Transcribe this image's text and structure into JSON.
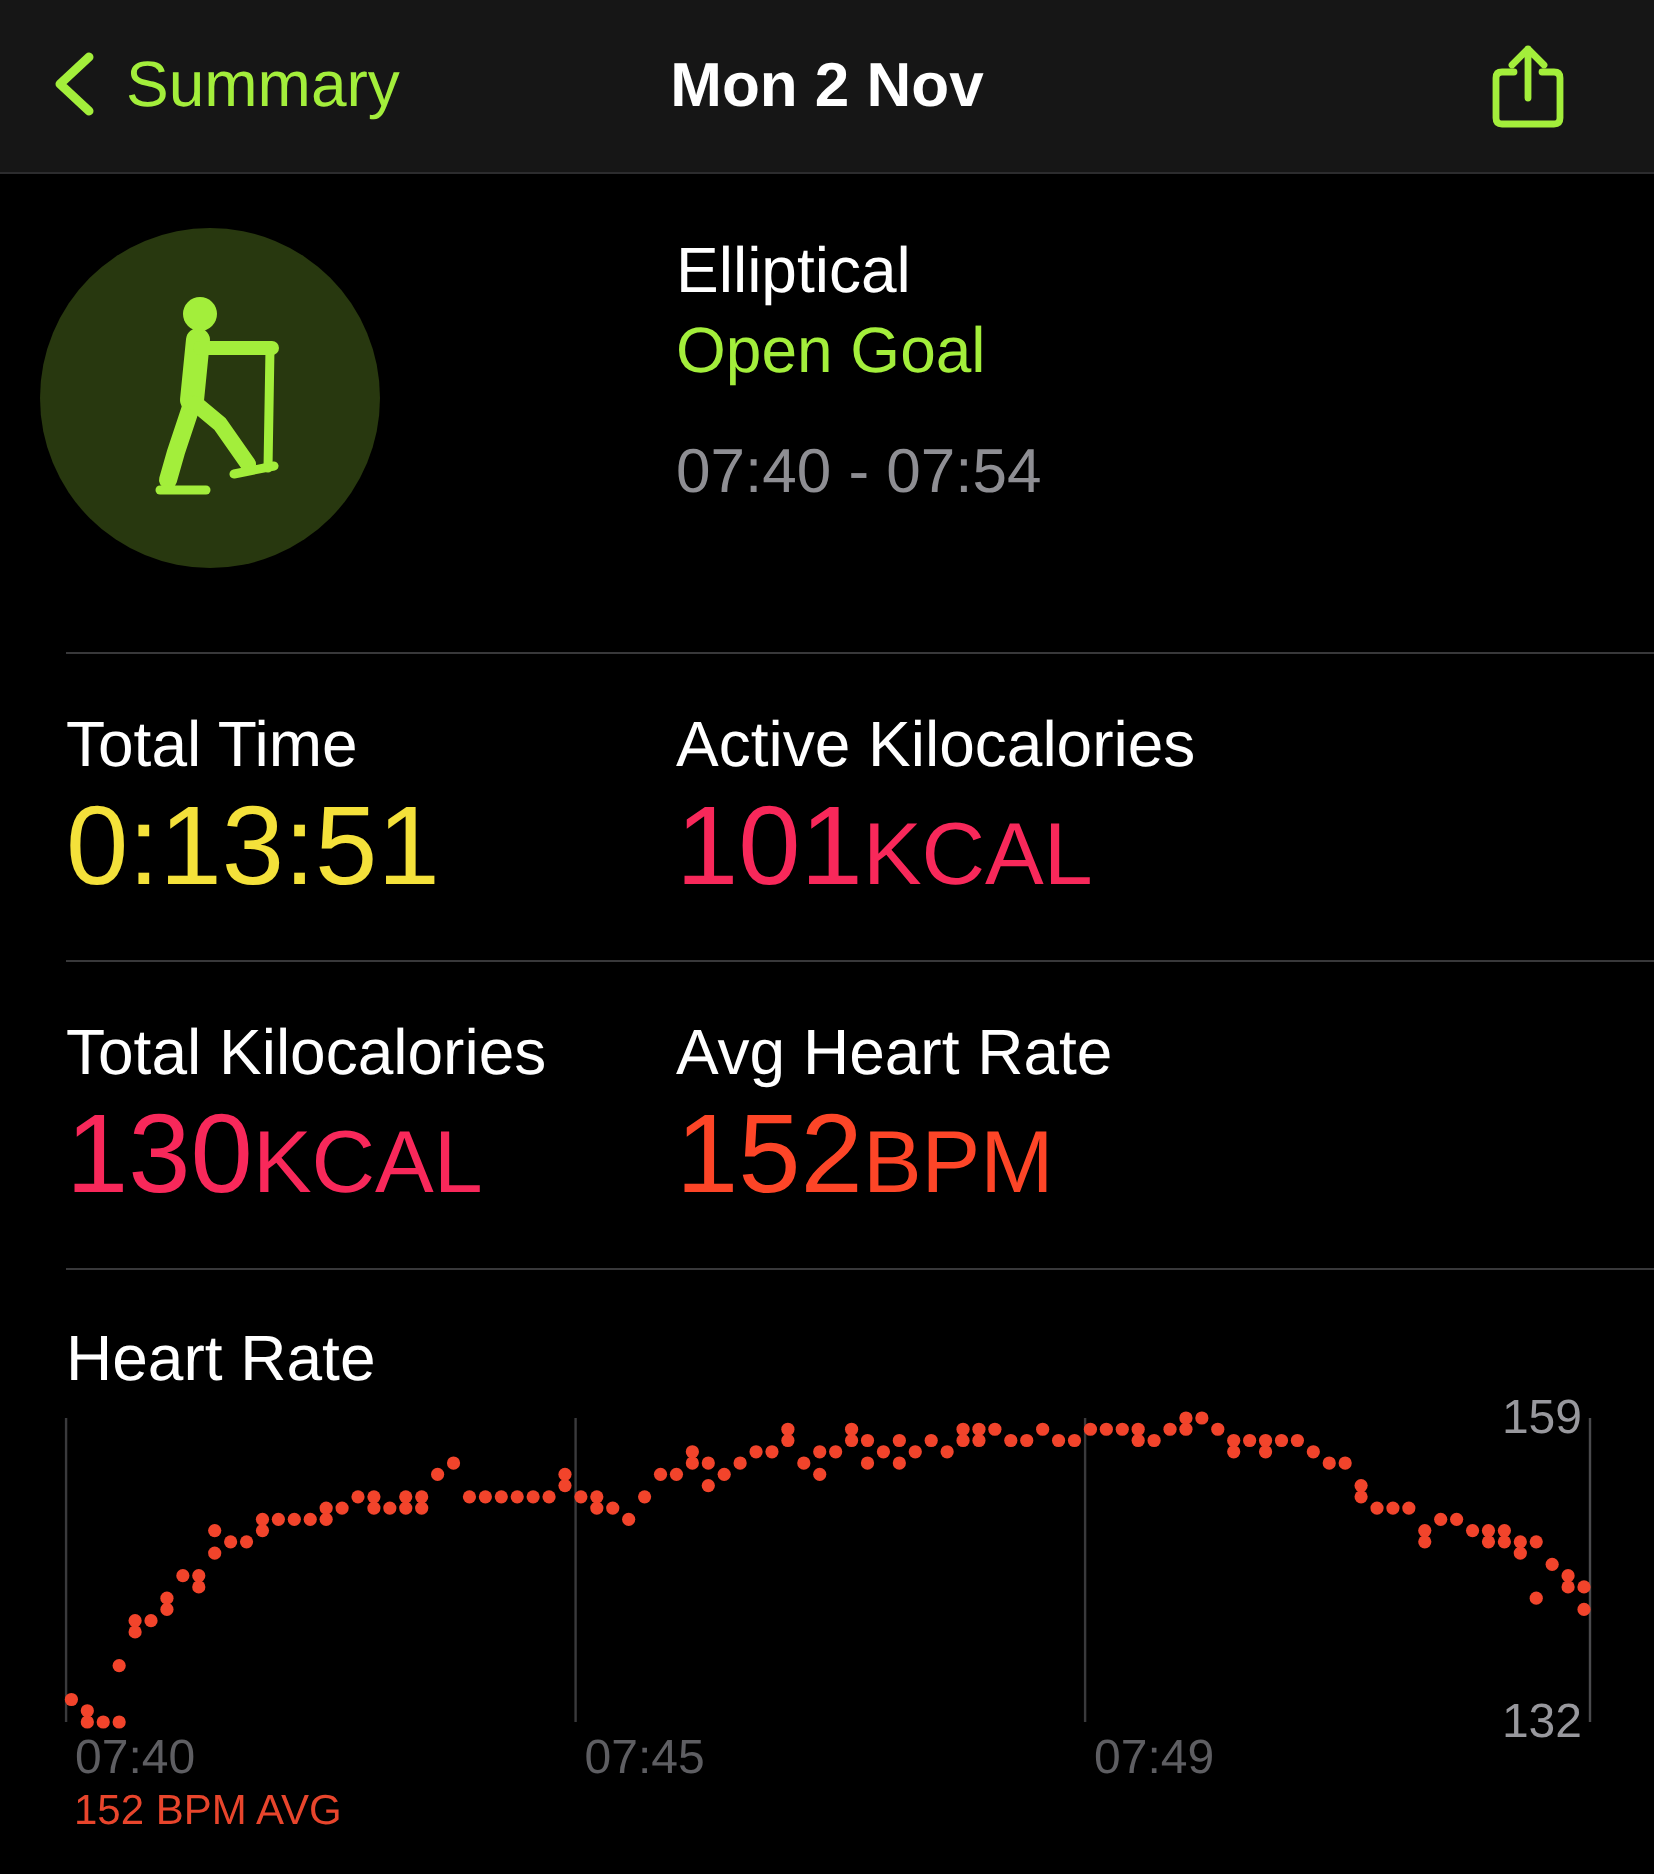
{
  "nav": {
    "back_label": "Summary",
    "title": "Mon 2 Nov"
  },
  "workout": {
    "type": "Elliptical",
    "goal": "Open Goal",
    "time_range": "07:40 - 07:54"
  },
  "stats": [
    {
      "label": "Total Time",
      "value": "0:13:51",
      "color": "#f4e13a"
    },
    {
      "label": "Active Kilocalories",
      "value": "101",
      "unit": "KCAL",
      "color": "#f8285a"
    },
    {
      "label": "Total Kilocalories",
      "value": "130",
      "unit": "KCAL",
      "color": "#f8285a"
    },
    {
      "label": "Avg Heart Rate",
      "value": "152",
      "unit": "BPM",
      "color": "#fd4527"
    }
  ],
  "heart_rate": {
    "title": "Heart Rate",
    "chart_data": {
      "type": "scatter",
      "ylim": [
        132,
        159
      ],
      "yticks": [
        159,
        132
      ],
      "categories": [
        null,
        null,
        null,
        null,
        "07:40",
        null,
        null,
        null,
        null,
        null,
        null,
        null,
        null,
        null,
        null,
        null,
        null,
        null,
        null,
        null,
        null,
        null,
        null,
        null,
        null,
        null,
        null,
        null,
        null,
        null,
        null,
        null,
        null,
        null,
        null,
        null,
        "07:45",
        null,
        null,
        null,
        null,
        null,
        null,
        null,
        null,
        null,
        null,
        null,
        null,
        null,
        null,
        null,
        null,
        null,
        null,
        null,
        null,
        null,
        null,
        null,
        null,
        null,
        null,
        null,
        null,
        null,
        null,
        null,
        "07:49",
        null,
        null,
        null,
        null,
        null,
        null,
        null,
        null,
        null,
        null,
        null,
        null,
        null,
        null,
        null,
        null,
        null,
        null,
        null,
        null,
        null,
        null,
        null,
        null,
        null,
        null,
        null
      ],
      "series": [
        {
          "color": "#f2442b",
          "values": [
            134,
            133,
            132,
            132,
            141,
            141,
            143,
            145,
            145,
            149,
            148,
            148,
            150,
            150,
            150,
            150,
            151,
            151,
            152,
            152,
            151,
            152,
            152,
            154,
            155,
            152,
            152,
            152,
            152,
            152,
            152,
            154,
            152,
            152,
            151,
            150,
            152,
            154,
            154,
            156,
            155,
            154,
            155,
            156,
            156,
            158,
            155,
            156,
            156,
            158,
            157,
            156,
            157,
            156,
            157,
            156,
            158,
            158,
            158,
            157,
            157,
            158,
            157,
            157,
            158,
            158,
            158,
            158,
            157,
            158,
            159,
            159,
            158,
            157,
            157,
            157,
            157,
            157,
            156,
            155,
            155,
            153,
            151,
            151,
            151,
            149,
            150,
            150,
            149,
            149,
            149,
            148,
            148,
            146,
            145,
            144
          ]
        },
        {
          "color": "#f2442b",
          "values": [
            null,
            132,
            null,
            137,
            140,
            null,
            142,
            null,
            144,
            147,
            null,
            null,
            149,
            null,
            null,
            null,
            150,
            null,
            null,
            151,
            null,
            151,
            151,
            null,
            null,
            null,
            null,
            null,
            null,
            null,
            null,
            153,
            null,
            151,
            null,
            null,
            null,
            null,
            null,
            155,
            153,
            null,
            null,
            null,
            null,
            157,
            null,
            154,
            null,
            157,
            155,
            null,
            155,
            null,
            null,
            null,
            157,
            157,
            null,
            null,
            null,
            null,
            null,
            null,
            null,
            null,
            null,
            157,
            null,
            null,
            158,
            null,
            null,
            156,
            null,
            156,
            null,
            null,
            null,
            null,
            null,
            152,
            null,
            null,
            null,
            148,
            null,
            null,
            null,
            148,
            148,
            147,
            143,
            null,
            144,
            142
          ]
        }
      ]
    },
    "average": "152 BPM AVG"
  }
}
